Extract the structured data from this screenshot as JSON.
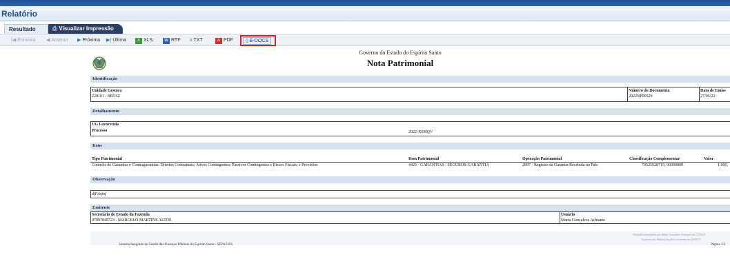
{
  "app": {
    "title": "Relatório"
  },
  "tabs": [
    {
      "label": "Resultado",
      "active": false
    },
    {
      "label": "Visualizar Impressão",
      "active": true
    }
  ],
  "toolbar": {
    "first": "Primeira",
    "prev": "Anterior",
    "next": "Próxima",
    "last": "Última",
    "xls": "XLS",
    "rtf": "RTF",
    "txt": "TXT",
    "pdf": "PDF",
    "edocs": "E-DOCS"
  },
  "report": {
    "government": "Governo do Estado do Espírito Santo",
    "title": "Nota Patrimonial",
    "identificacao": {
      "header": "Identificação",
      "unidade_label": "Unidade Gestora",
      "unidade_value": "220101 - SEFAZ",
      "numero_label": "Número do Documento",
      "numero_value": "2022NP00529",
      "data_label": "Data de Emiss",
      "data_value": "27/06/22"
    },
    "detalhamento": {
      "header": "Detalhamento",
      "ug_label": "UG Favorecida",
      "processo_label": "Processo",
      "processo_value": "2022-X6MQV"
    },
    "itens": {
      "header": "Itens",
      "columns": [
        "Tipo Patrimonial",
        "Item Patrimonial",
        "Operação Patrimonial",
        "Classificação Complementar",
        "Valor"
      ],
      "row": {
        "tipo": "Controle de Garantias e Contragarantias; Direitos Contratuais; Ativos Contingentes; Passivos Contingentes e Riscos Fiscais; e Provisões",
        "item": "4426 - GARANTIAS : SEGUROS-GARANTIA",
        "operacao": "2897 - Registro da Garantia Recebida no País",
        "classificacao": "70525528715; 00000000",
        "valor": "1.000,"
      }
    },
    "observacao": {
      "header": "Observação",
      "text": "dfFdafaf"
    },
    "emitente": {
      "header": "Emitente",
      "orgao_label": "Secretário de Estado da Fazenda",
      "orgao_value": "07097848723 - MARCELO MARTINS ALTOE",
      "usuario_label": "Usuário",
      "usuario_value": "Marta Gonçalves Achiame"
    },
    "footer": {
      "note1": "Emitido/consolidado por Marta Gonçalves Achiame em 27/06/22",
      "note2": "Impresso por Marta Gonçalves Achiame em 28/06/22",
      "system": "Sistema Integrado de Gestão das Finanças Públicas do Espírito Santo - SEFAZ-ES",
      "page": "Página 1/2"
    }
  },
  "colors": {
    "brand": "#1d4f93",
    "highlight": "#e02020",
    "section": "#d7e1ee"
  }
}
